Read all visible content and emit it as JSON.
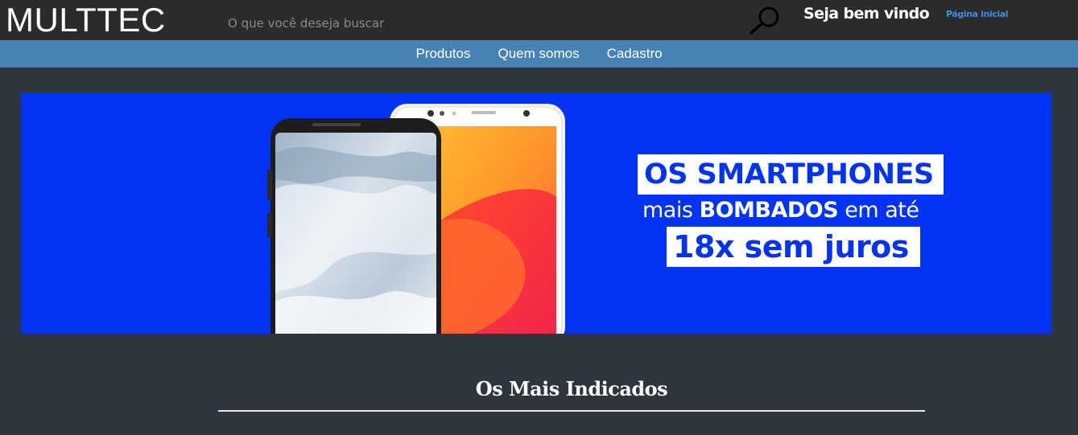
{
  "header": {
    "logo": "MULTTEC",
    "search": {
      "placeholder": "O que você deseja buscar",
      "value": ""
    },
    "welcome": "Seja bem vindo",
    "home_link": "Página inicial"
  },
  "nav": {
    "items": [
      {
        "label": "Produtos"
      },
      {
        "label": "Quem somos"
      },
      {
        "label": "Cadastro"
      }
    ]
  },
  "banner": {
    "line1": "OS SMARTPHONES",
    "line2_pre": "mais ",
    "line2_bold": "BOMBADOS",
    "line2_post": " em até",
    "line3": "18x sem juros",
    "background_color": "#0133f4"
  },
  "section": {
    "title": "Os Mais Indicados"
  },
  "colors": {
    "header_bg": "#2b2b2b",
    "nav_bg": "#4682b4",
    "page_bg": "#2e353d",
    "link": "#3f8fe0"
  }
}
